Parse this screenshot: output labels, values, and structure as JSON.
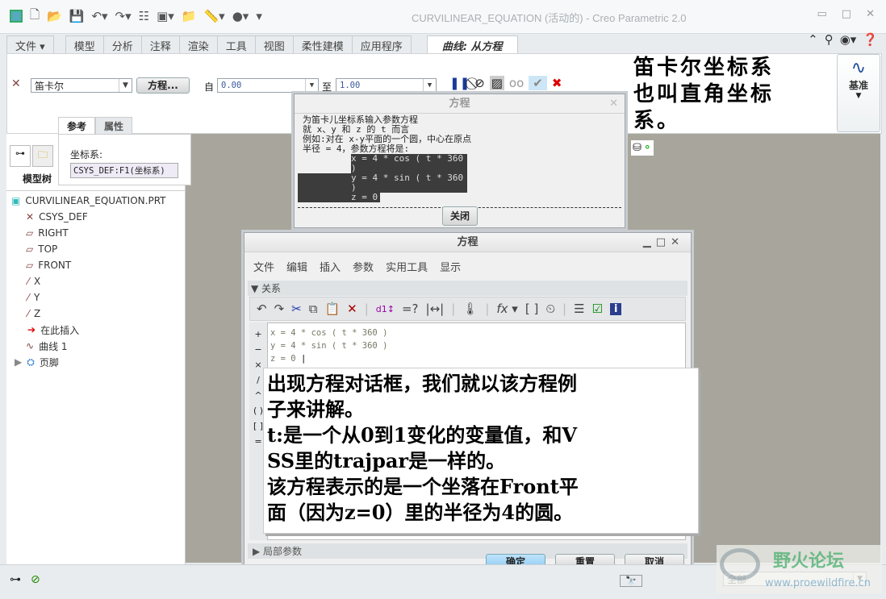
{
  "window": {
    "title": "CURVILINEAR_EQUATION (活动的) - Creo Parametric 2.0"
  },
  "ribbon": {
    "tabs": [
      "文件",
      "模型",
      "分析",
      "注释",
      "渲染",
      "工具",
      "视图",
      "柔性建模",
      "应用程序"
    ],
    "active_tab": "曲线: 从方程",
    "coord_type": "笛卡尔",
    "equation_button": "方程...",
    "from_label": "自",
    "from_value": "0.00",
    "to_label": "至",
    "to_value": "1.00",
    "datum_label": "基准"
  },
  "subtabs": [
    "参考",
    "属性"
  ],
  "reference_popup": {
    "label": "坐标系:",
    "value": "CSYS_DEF:F1(坐标系)"
  },
  "model_tree": {
    "title": "模型树",
    "items": [
      "CURVILINEAR_EQUATION.PRT",
      "CSYS_DEF",
      "RIGHT",
      "TOP",
      "FRONT",
      "X",
      "Y",
      "Z",
      "在此插入",
      "曲线 1",
      "页脚"
    ]
  },
  "help_dialog": {
    "title": "方程",
    "lines": [
      "为笛卡儿坐标系输入参数方程",
      "就 x、y 和 z 的 t 而言",
      "例如:对在 x-y平面的一个圆，中心在原点",
      "半径 = 4，参数方程将是:"
    ],
    "equations": [
      "x = 4 * cos ( t * 360 )",
      "y = 4 * sin ( t * 360 )",
      "z = 0"
    ],
    "close_button": "关闭"
  },
  "eq_dialog": {
    "title": "方程",
    "menu": [
      "文件",
      "编辑",
      "插入",
      "参数",
      "实用工具",
      "显示"
    ],
    "section": "关系",
    "side_ops": [
      "+",
      "−",
      "×",
      "/",
      "^",
      "( )",
      "[ ]",
      "="
    ],
    "editor_lines": [
      "x = 4 * cos ( t * 360 )",
      "y = 4 * sin ( t * 360 )",
      "z = 0"
    ],
    "local_params": "局部参数",
    "ok": "确定",
    "reset": "重置",
    "cancel": "取消"
  },
  "annotations": {
    "top": [
      "笛卡尔坐标系",
      "也叫直角坐标",
      "系。"
    ],
    "body": [
      "出现方程对话框，我们就以该方程例",
      "子来讲解。",
      "t:是一个从0到1变化的变量值，和V",
      "SS里的trajpar是一样的。",
      "该方程表示的是一个坐落在Front平",
      "面（因为z=0）里的半径为4的圆。"
    ]
  },
  "status": {
    "filter": "全部"
  },
  "watermark": {
    "name": "野火论坛",
    "url": "www.proewildfire.cn"
  }
}
